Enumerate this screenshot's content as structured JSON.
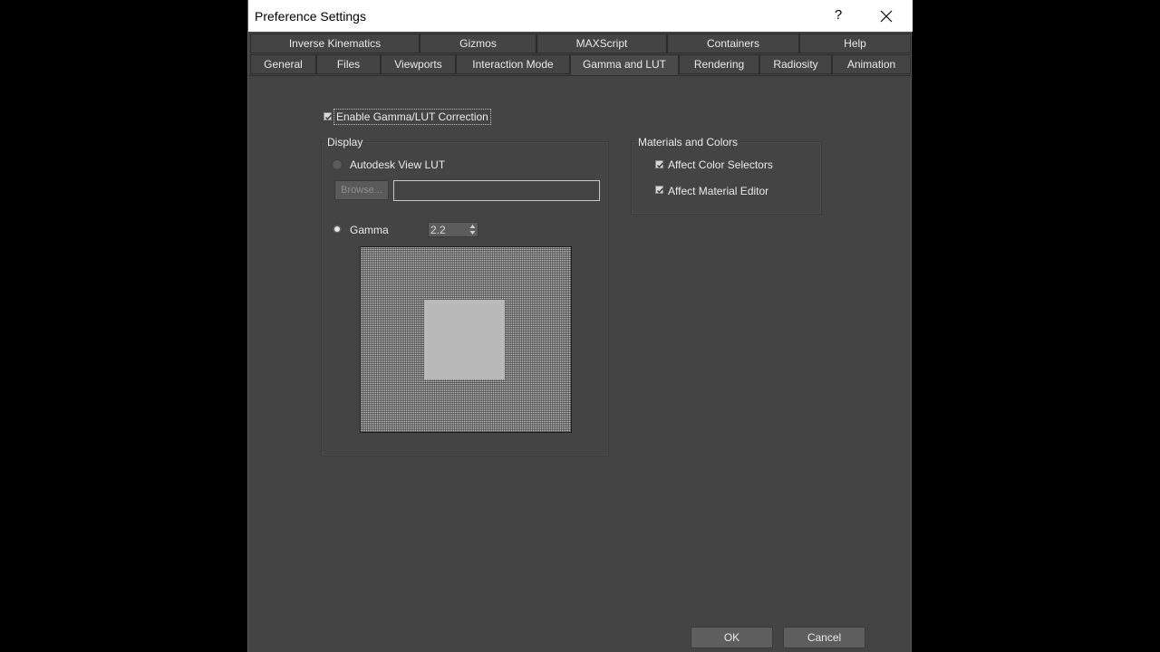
{
  "window": {
    "title": "Preference Settings",
    "help_label": "?"
  },
  "tabs": {
    "row1": [
      "Inverse Kinematics",
      "Gizmos",
      "MAXScript",
      "Containers",
      "Help"
    ],
    "row2": [
      "General",
      "Files",
      "Viewports",
      "Interaction Mode",
      "Gamma and LUT",
      "Rendering",
      "Radiosity",
      "Animation"
    ],
    "active": "Gamma and LUT"
  },
  "gamma_lut": {
    "enable_label": "Enable Gamma/LUT Correction",
    "enable_checked": true,
    "display": {
      "title": "Display",
      "lut_label": "Autodesk View LUT",
      "lut_selected": false,
      "browse_label": "Browse...",
      "lut_path": "",
      "gamma_label": "Gamma",
      "gamma_selected": true,
      "gamma_value": "2.2"
    },
    "materials": {
      "title": "Materials and Colors",
      "affect_color_selectors_label": "Affect Color Selectors",
      "affect_color_selectors_checked": true,
      "affect_material_editor_label": "Affect Material Editor",
      "affect_material_editor_checked": true
    }
  },
  "buttons": {
    "ok_label": "OK",
    "cancel_label": "Cancel"
  }
}
